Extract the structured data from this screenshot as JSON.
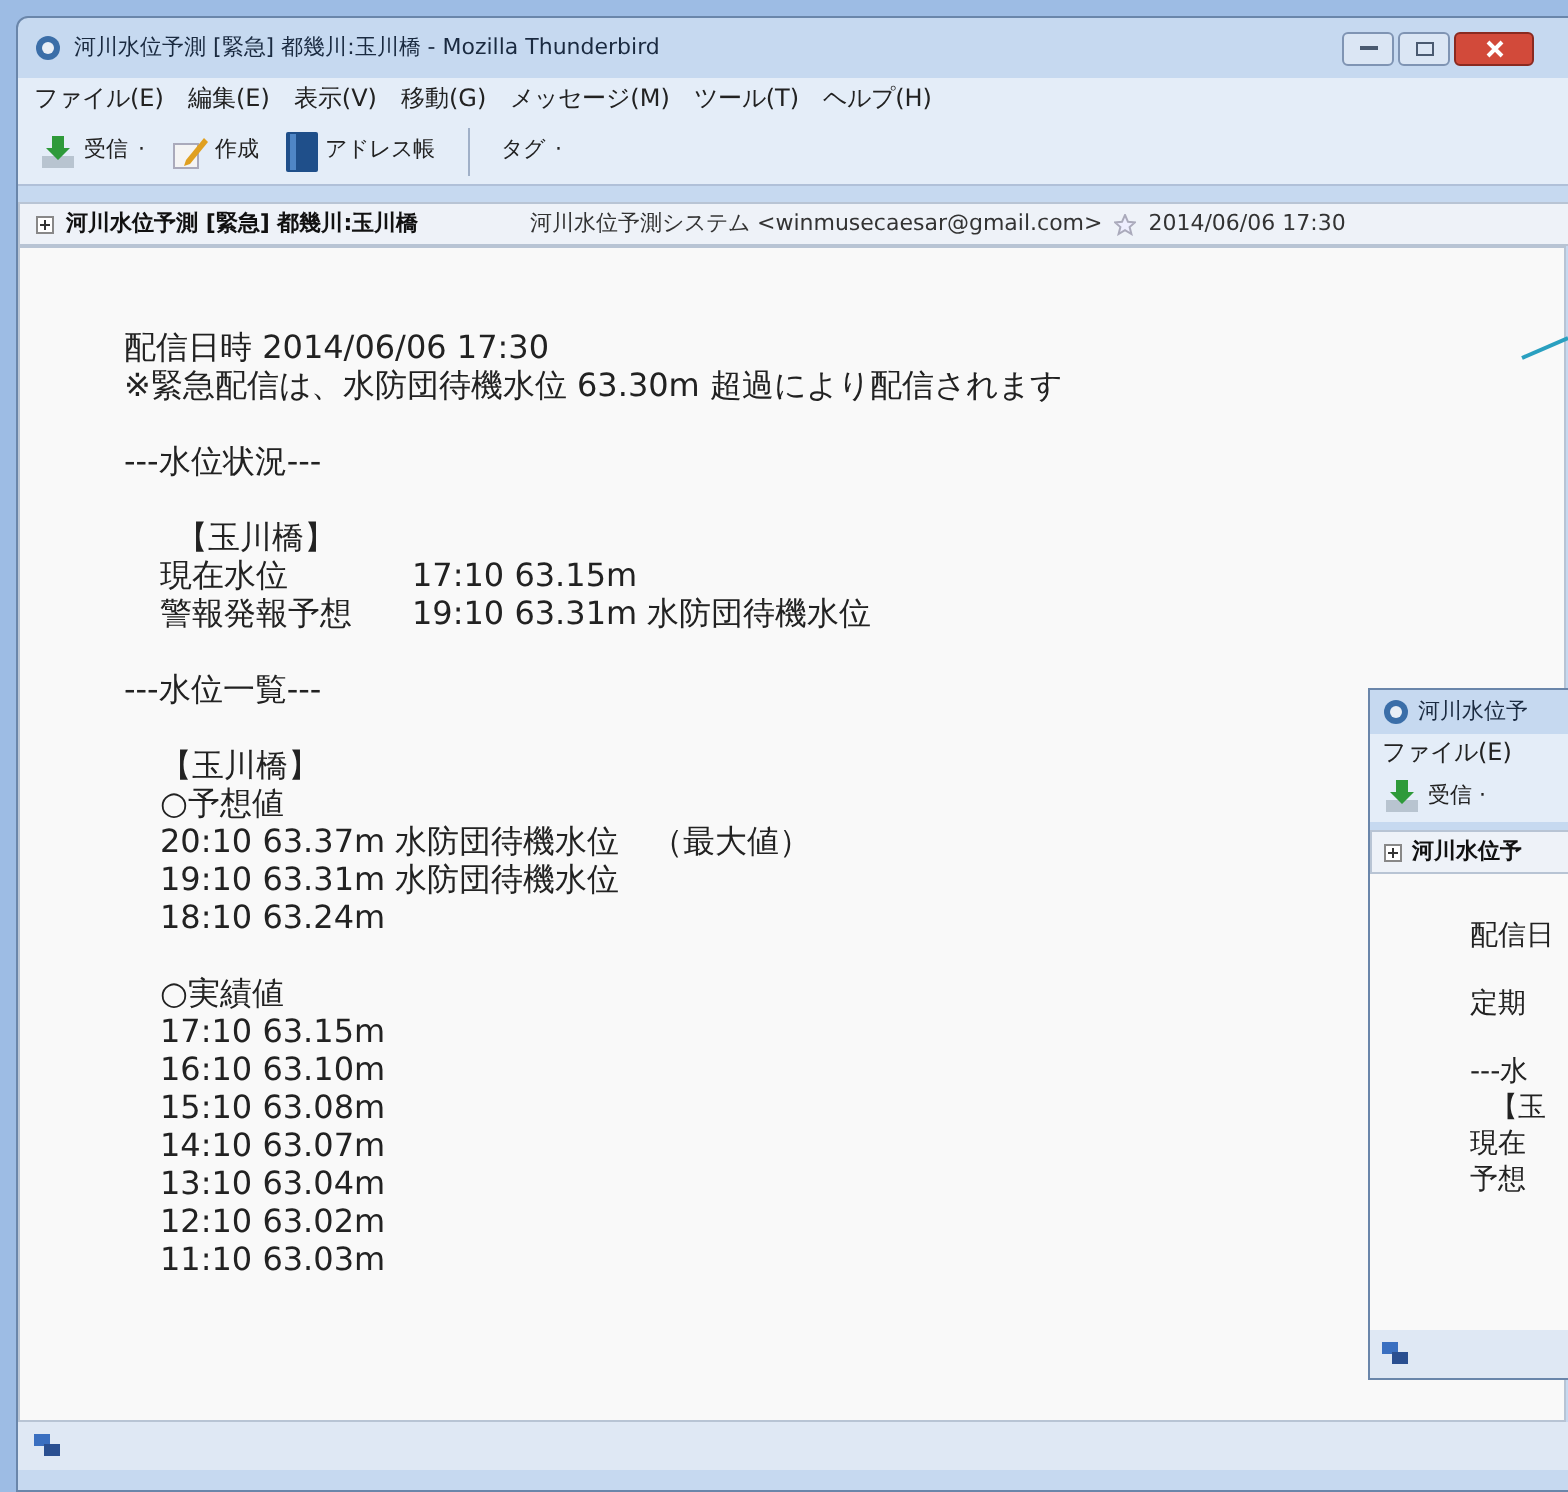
{
  "window": {
    "title": "河川水位予測 [緊急] 都幾川:玉川橋 - Mozilla Thunderbird"
  },
  "menu": [
    "ファイル(E)",
    "編集(E)",
    "表示(V)",
    "移動(G)",
    "メッセージ(M)",
    "ツール(T)",
    "ヘルプ(H)"
  ],
  "toolbar": [
    {
      "kind": "get",
      "label": "受信",
      "dropdown": "·"
    },
    {
      "kind": "write",
      "label": "作成"
    },
    {
      "kind": "address",
      "label": "アドレス帳"
    },
    {
      "kind": "separator"
    },
    {
      "kind": "tag",
      "label": "タグ",
      "dropdown": "·"
    }
  ],
  "header": {
    "subject": "河川水位予測 [緊急] 都幾川:玉川橋",
    "from": "河川水位予測システム <winmusecaesar@gmail.com>",
    "date": "2014/06/06 17:30"
  },
  "body": [
    {
      "kind": "lines",
      "indent": false,
      "lines": [
        "配信日時 2014/06/06 17:30",
        "※緊急配信は、水防団待機水位 63.30m 超過により配信されます"
      ]
    },
    {
      "kind": "lines",
      "indent": false,
      "lines": [
        "---水位状況---"
      ]
    },
    {
      "kind": "table",
      "indent": true,
      "title": "【玉川橋】",
      "rows": [
        {
          "label": "現在水位",
          "value": "17:10 63.15m"
        },
        {
          "label": "警報発報予想",
          "value": "19:10 63.31m 水防団待機水位"
        }
      ]
    },
    {
      "kind": "lines",
      "indent": false,
      "lines": [
        "---水位一覧---"
      ]
    },
    {
      "kind": "lines",
      "indent": true,
      "lines": [
        "【玉川橋】",
        "○予想値",
        "20:10 63.37m 水防団待機水位　（最大値）",
        "19:10 63.31m 水防団待機水位",
        "18:10 63.24m"
      ]
    },
    {
      "kind": "lines",
      "indent": true,
      "lines": [
        "○実績値",
        "17:10 63.15m",
        "16:10 63.10m",
        "15:10 63.08m",
        "14:10 63.07m",
        "13:10 63.04m",
        "12:10 63.02m",
        "11:10 63.03m"
      ]
    }
  ],
  "second_window": {
    "title": "河川水位予",
    "menu": "ファイル(E)",
    "toolbar": "受信 ·",
    "subject": "河川水位予",
    "lines": [
      "配信日",
      "定期",
      "---水",
      "【玉",
      "現在",
      "予想"
    ]
  }
}
